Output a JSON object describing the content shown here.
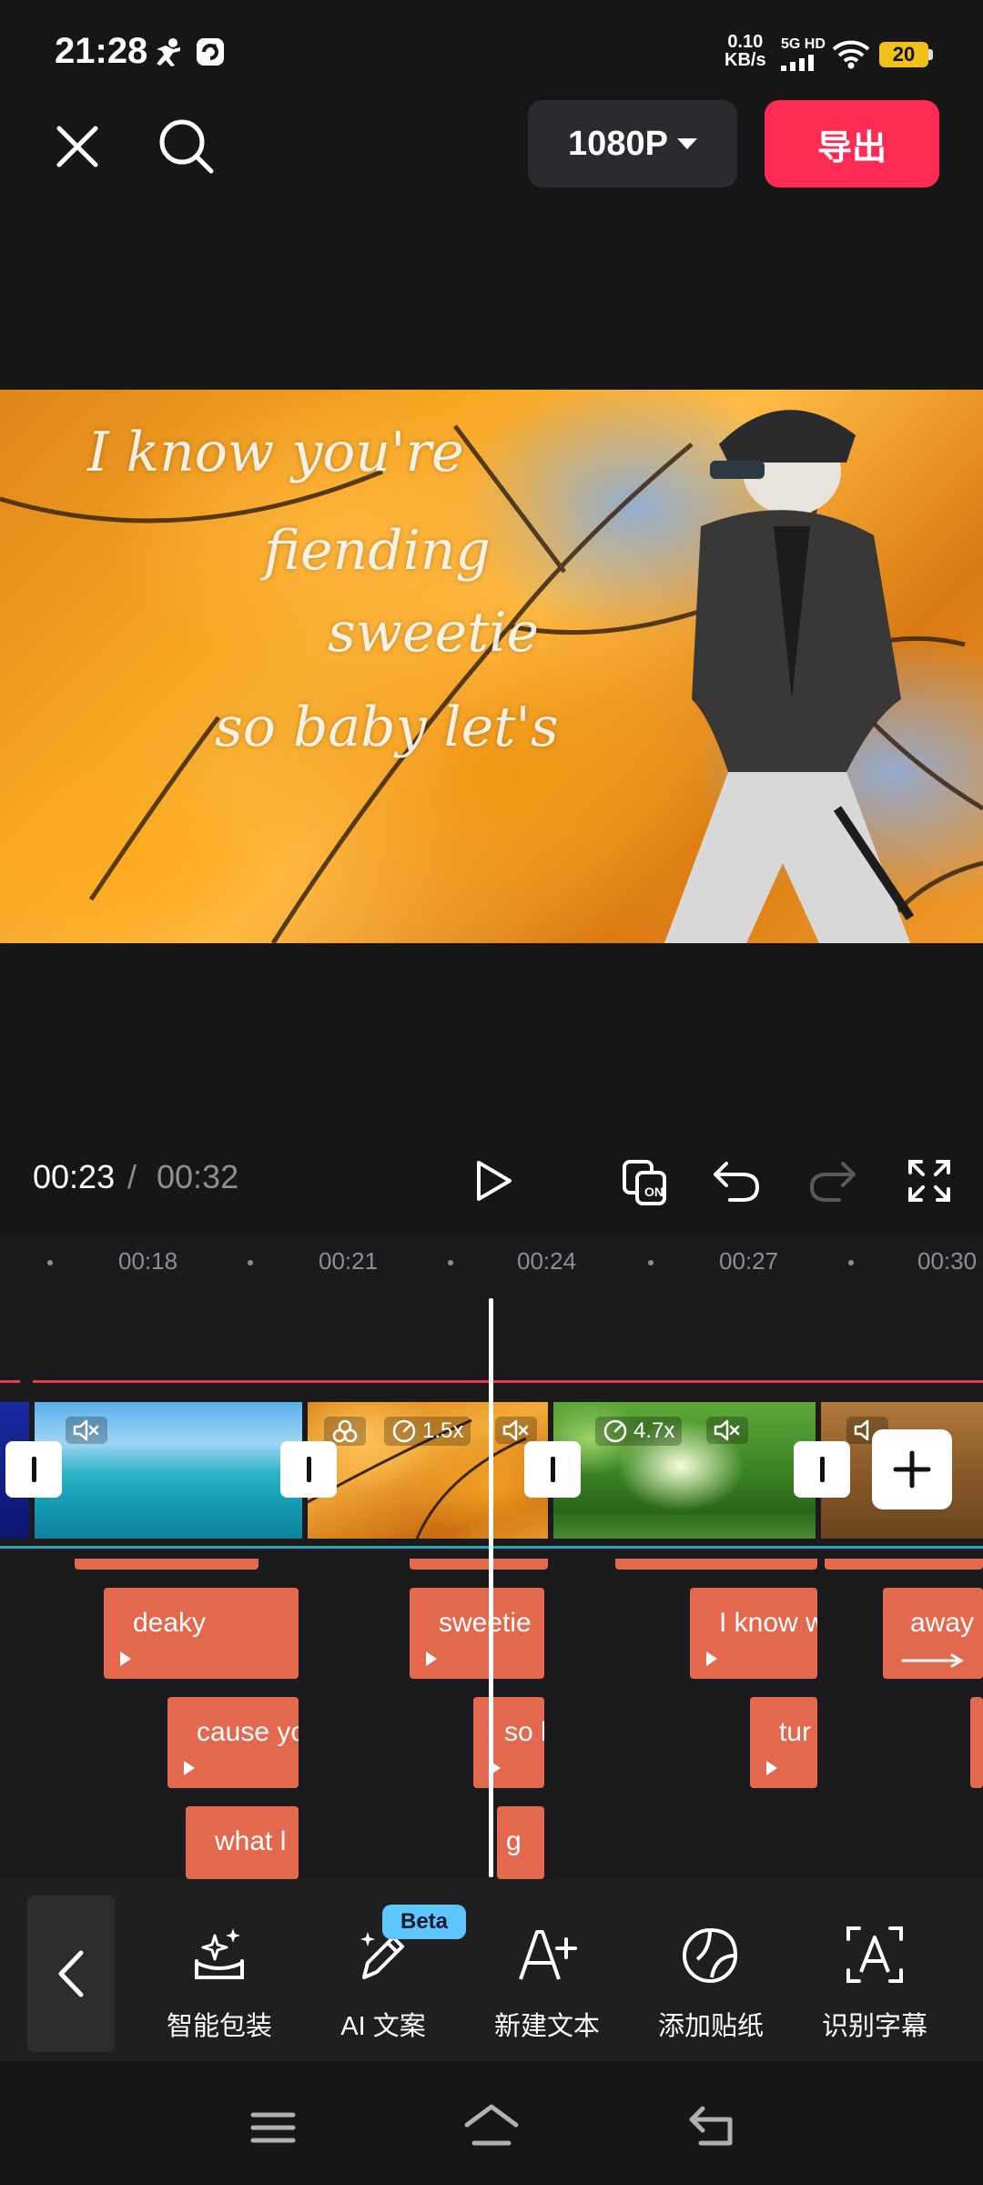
{
  "status_bar": {
    "time": "21:28",
    "net_speed_value": "0.10",
    "net_speed_unit": "KB/s",
    "network_type": "5G HD",
    "battery": "20",
    "icons": [
      "figure-icon",
      "app-notification-icon",
      "signal-icon",
      "wifi-icon",
      "battery-icon"
    ]
  },
  "top_bar": {
    "resolution": "1080P",
    "export_label": "导出",
    "icons": [
      "close-icon",
      "search-icon",
      "caret-down-icon"
    ]
  },
  "preview": {
    "lyrics": [
      "I know you're",
      "fiending",
      "sweetie",
      "so baby let's"
    ]
  },
  "playback": {
    "current_time": "00:23",
    "separator": "/",
    "total_time": "00:32",
    "icons": [
      "play-icon",
      "compare-on-icon",
      "undo-icon",
      "redo-icon",
      "fullscreen-icon"
    ]
  },
  "timeline": {
    "ruler_ticks": [
      "00:18",
      "00:21",
      "00:24",
      "00:27",
      "00:30"
    ],
    "clips": [
      {
        "name": "ocean",
        "muted": true,
        "speed": ""
      },
      {
        "name": "autumn-leaves",
        "muted": true,
        "speed": "1.5x"
      },
      {
        "name": "green-forest",
        "muted": true,
        "speed": "4.7x"
      },
      {
        "name": "brown-clip",
        "muted": true,
        "speed": ""
      }
    ],
    "text_clips": [
      {
        "label": "deaky"
      },
      {
        "label": "cause yo"
      },
      {
        "label": "what l"
      },
      {
        "label": "sweetie"
      },
      {
        "label": "so b"
      },
      {
        "label": "g"
      },
      {
        "label": "I know w"
      },
      {
        "label": "tur"
      },
      {
        "label": "away"
      }
    ]
  },
  "toolbar": {
    "items": [
      {
        "label": "智能包装",
        "icon": "smart-package-icon"
      },
      {
        "label": "AI 文案",
        "icon": "ai-copywriting-icon",
        "badge": "Beta"
      },
      {
        "label": "新建文本",
        "icon": "new-text-icon"
      },
      {
        "label": "添加贴纸",
        "icon": "sticker-icon"
      },
      {
        "label": "识别字幕",
        "icon": "recognize-captions-icon"
      }
    ]
  },
  "nav_bar": {
    "icons": [
      "menu-icon",
      "home-icon",
      "back-icon"
    ]
  },
  "colors": {
    "background": "#161617",
    "accent": "#fe2c55",
    "text_clip": "#e2694e",
    "beta_badge": "#5ec6ff"
  }
}
